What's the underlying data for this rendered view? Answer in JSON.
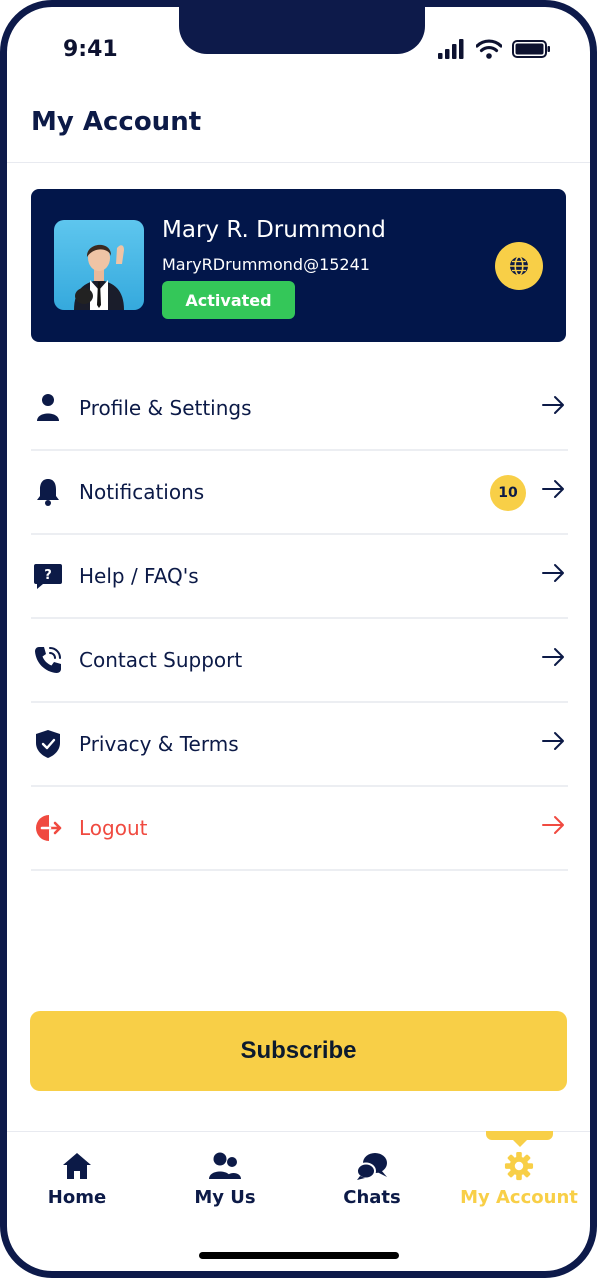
{
  "status_bar": {
    "time": "9:41"
  },
  "page": {
    "title": "My Account"
  },
  "profile": {
    "name": "Mary R. Drummond",
    "username": "MaryRDrummond@15241",
    "status": "Activated"
  },
  "menu": {
    "items": [
      {
        "label": "Profile & Settings",
        "icon": "user-icon"
      },
      {
        "label": "Notifications",
        "icon": "bell-icon",
        "badge": "10"
      },
      {
        "label": "Help / FAQ's",
        "icon": "help-chat-icon"
      },
      {
        "label": "Contact Support",
        "icon": "phone-icon"
      },
      {
        "label": "Privacy & Terms",
        "icon": "shield-check-icon"
      },
      {
        "label": "Logout",
        "icon": "logout-icon"
      }
    ]
  },
  "subscribe": {
    "label": "Subscribe"
  },
  "tabbar": {
    "tabs": [
      {
        "label": "Home",
        "icon": "home-icon"
      },
      {
        "label": "My Us",
        "icon": "users-icon"
      },
      {
        "label": "Chats",
        "icon": "chat-bubbles-icon"
      },
      {
        "label": "My Account",
        "icon": "gear-icon",
        "active": true
      }
    ]
  },
  "colors": {
    "navy": "#0c1a47",
    "card": "#02164a",
    "accent": "#f8cf47",
    "success": "#34c759",
    "danger": "#f04a40"
  }
}
